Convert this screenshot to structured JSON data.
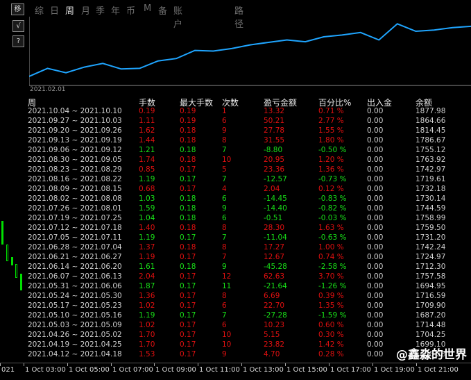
{
  "tabs": {
    "move_icon_label": "移",
    "items": [
      "综",
      "日",
      "周",
      "月",
      "季",
      "年",
      "币",
      "M",
      "备",
      "账户"
    ],
    "active_index": 2,
    "path_label": "路径"
  },
  "tools": {
    "check_label": "√",
    "help_label": "?"
  },
  "equity_chart": {
    "start_date_label": "2021.02.01",
    "line_color": "#1fa5ff",
    "values": [
      1699,
      1712,
      1705,
      1714,
      1720,
      1711,
      1712,
      1724,
      1728,
      1741,
      1740,
      1744,
      1750,
      1754,
      1758,
      1755,
      1763,
      1766,
      1770,
      1758,
      1784,
      1772,
      1774,
      1778,
      1780
    ]
  },
  "table": {
    "headers": [
      "周",
      "手数",
      "最大手数",
      "次数",
      "盈亏金额",
      "百分比%",
      "出入金",
      "余额"
    ],
    "rows": [
      {
        "period": "2021.10.04 ~ 2021.10.10",
        "lots": "0.19",
        "max_lots": "0.19",
        "count": "1",
        "pnl": "13.32",
        "pct": "0.71 %",
        "flow": "0.00",
        "balance": "1877.98",
        "sign": "pos"
      },
      {
        "period": "2021.09.27 ~ 2021.10.03",
        "lots": "1.11",
        "max_lots": "0.19",
        "count": "6",
        "pnl": "50.21",
        "pct": "2.77 %",
        "flow": "0.00",
        "balance": "1864.66",
        "sign": "pos"
      },
      {
        "period": "2021.09.20 ~ 2021.09.26",
        "lots": "1.62",
        "max_lots": "0.18",
        "count": "9",
        "pnl": "27.78",
        "pct": "1.55 %",
        "flow": "0.00",
        "balance": "1814.45",
        "sign": "pos"
      },
      {
        "period": "2021.09.13 ~ 2021.09.19",
        "lots": "1.44",
        "max_lots": "0.18",
        "count": "8",
        "pnl": "31.55",
        "pct": "1.80 %",
        "flow": "0.00",
        "balance": "1786.67",
        "sign": "pos"
      },
      {
        "period": "2021.09.06 ~ 2021.09.12",
        "lots": "1.21",
        "max_lots": "0.18",
        "count": "7",
        "pnl": "-8.80",
        "pct": "-0.50 %",
        "flow": "0.00",
        "balance": "1755.12",
        "sign": "neg"
      },
      {
        "period": "2021.08.30 ~ 2021.09.05",
        "lots": "1.74",
        "max_lots": "0.18",
        "count": "10",
        "pnl": "20.95",
        "pct": "1.20 %",
        "flow": "0.00",
        "balance": "1763.92",
        "sign": "pos"
      },
      {
        "period": "2021.08.23 ~ 2021.08.29",
        "lots": "0.85",
        "max_lots": "0.17",
        "count": "5",
        "pnl": "23.36",
        "pct": "1.36 %",
        "flow": "0.00",
        "balance": "1742.97",
        "sign": "pos"
      },
      {
        "period": "2021.08.16 ~ 2021.08.22",
        "lots": "1.19",
        "max_lots": "0.17",
        "count": "7",
        "pnl": "-12.57",
        "pct": "-0.73 %",
        "flow": "0.00",
        "balance": "1719.61",
        "sign": "neg"
      },
      {
        "period": "2021.08.09 ~ 2021.08.15",
        "lots": "0.68",
        "max_lots": "0.17",
        "count": "4",
        "pnl": "2.04",
        "pct": "0.12 %",
        "flow": "0.00",
        "balance": "1732.18",
        "sign": "pos"
      },
      {
        "period": "2021.08.02 ~ 2021.08.08",
        "lots": "1.03",
        "max_lots": "0.18",
        "count": "6",
        "pnl": "-14.45",
        "pct": "-0.83 %",
        "flow": "0.00",
        "balance": "1730.14",
        "sign": "neg"
      },
      {
        "period": "2021.07.26 ~ 2021.08.01",
        "lots": "1.59",
        "max_lots": "0.18",
        "count": "9",
        "pnl": "-14.40",
        "pct": "-0.82 %",
        "flow": "0.00",
        "balance": "1744.59",
        "sign": "neg"
      },
      {
        "period": "2021.07.19 ~ 2021.07.25",
        "lots": "1.04",
        "max_lots": "0.18",
        "count": "6",
        "pnl": "-0.51",
        "pct": "-0.03 %",
        "flow": "0.00",
        "balance": "1758.99",
        "sign": "neg"
      },
      {
        "period": "2021.07.12 ~ 2021.07.18",
        "lots": "1.40",
        "max_lots": "0.18",
        "count": "8",
        "pnl": "28.30",
        "pct": "1.63 %",
        "flow": "0.00",
        "balance": "1759.50",
        "sign": "pos"
      },
      {
        "period": "2021.07.05 ~ 2021.07.11",
        "lots": "1.19",
        "max_lots": "0.17",
        "count": "7",
        "pnl": "-11.04",
        "pct": "-0.63 %",
        "flow": "0.00",
        "balance": "1731.20",
        "sign": "neg"
      },
      {
        "period": "2021.06.28 ~ 2021.07.04",
        "lots": "1.37",
        "max_lots": "0.18",
        "count": "8",
        "pnl": "17.27",
        "pct": "1.00 %",
        "flow": "0.00",
        "balance": "1742.24",
        "sign": "pos"
      },
      {
        "period": "2021.06.21 ~ 2021.06.27",
        "lots": "1.19",
        "max_lots": "0.17",
        "count": "7",
        "pnl": "12.67",
        "pct": "0.74 %",
        "flow": "0.00",
        "balance": "1724.97",
        "sign": "pos"
      },
      {
        "period": "2021.06.14 ~ 2021.06.20",
        "lots": "1.61",
        "max_lots": "0.18",
        "count": "9",
        "pnl": "-45.28",
        "pct": "-2.58 %",
        "flow": "0.00",
        "balance": "1712.30",
        "sign": "neg"
      },
      {
        "period": "2021.06.07 ~ 2021.06.13",
        "lots": "2.04",
        "max_lots": "0.17",
        "count": "12",
        "pnl": "62.63",
        "pct": "3.70 %",
        "flow": "0.00",
        "balance": "1757.58",
        "sign": "pos"
      },
      {
        "period": "2021.05.31 ~ 2021.06.06",
        "lots": "1.87",
        "max_lots": "0.17",
        "count": "11",
        "pnl": "-21.64",
        "pct": "-1.26 %",
        "flow": "0.00",
        "balance": "1694.95",
        "sign": "neg"
      },
      {
        "period": "2021.05.24 ~ 2021.05.30",
        "lots": "1.36",
        "max_lots": "0.17",
        "count": "8",
        "pnl": "6.69",
        "pct": "0.39 %",
        "flow": "0.00",
        "balance": "1716.59",
        "sign": "pos"
      },
      {
        "period": "2021.05.17 ~ 2021.05.23",
        "lots": "1.02",
        "max_lots": "0.17",
        "count": "6",
        "pnl": "22.70",
        "pct": "1.35 %",
        "flow": "0.00",
        "balance": "1709.90",
        "sign": "pos"
      },
      {
        "period": "2021.05.10 ~ 2021.05.16",
        "lots": "1.19",
        "max_lots": "0.17",
        "count": "7",
        "pnl": "-27.28",
        "pct": "-1.59 %",
        "flow": "0.00",
        "balance": "1687.20",
        "sign": "neg"
      },
      {
        "period": "2021.05.03 ~ 2021.05.09",
        "lots": "1.02",
        "max_lots": "0.17",
        "count": "6",
        "pnl": "10.23",
        "pct": "0.60 %",
        "flow": "0.00",
        "balance": "1714.48",
        "sign": "pos"
      },
      {
        "period": "2021.04.26 ~ 2021.05.02",
        "lots": "1.70",
        "max_lots": "0.17",
        "count": "10",
        "pnl": "5.15",
        "pct": "0.30 %",
        "flow": "0.00",
        "balance": "1704.25",
        "sign": "pos"
      },
      {
        "period": "2021.04.19 ~ 2021.04.25",
        "lots": "1.70",
        "max_lots": "0.17",
        "count": "10",
        "pnl": "23.82",
        "pct": "1.42 %",
        "flow": "0.00",
        "balance": "1699.10",
        "sign": "pos"
      },
      {
        "period": "2021.04.12 ~ 2021.04.18",
        "lots": "1.53",
        "max_lots": "0.17",
        "count": "9",
        "pnl": "4.70",
        "pct": "0.28 %",
        "flow": "0.00",
        "balance": "1675.28",
        "sign": "pos"
      }
    ]
  },
  "time_axis": {
    "labels": [
      "021",
      "1 Oct 03:00",
      "1 Oct 05:00",
      "1 Oct 07:00",
      "1 Oct 09:00",
      "1 Oct 11:00",
      "1 Oct 13:00",
      "1 Oct 15:00",
      "1 Oct 17:00",
      "1 Oct 19:00",
      "1 Oct 21:00"
    ]
  },
  "watermark": {
    "text": "@鑫淼的世界"
  },
  "colors": {
    "positive": "#e01010",
    "negative": "#18e018",
    "neutral": "#d0d0d0",
    "candles": "#00e000"
  }
}
